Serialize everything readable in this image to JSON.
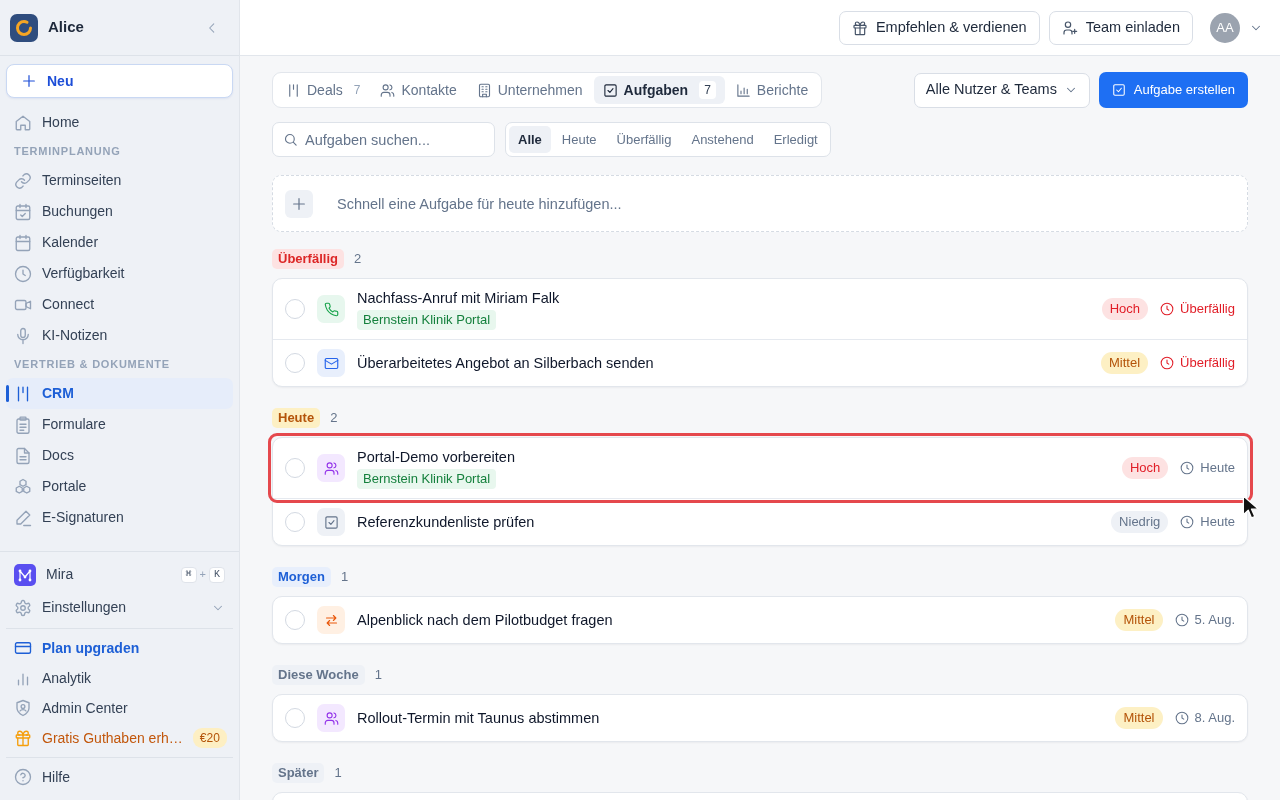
{
  "sidebar": {
    "workspace": "Alice",
    "new_button": "Neu",
    "nav": [
      {
        "kind": "item",
        "label": "Home",
        "selected": false
      },
      {
        "kind": "heading",
        "label": "TERMINPLANUNG"
      },
      {
        "kind": "item",
        "label": "Terminseiten",
        "selected": false
      },
      {
        "kind": "item",
        "label": "Buchungen",
        "selected": false
      },
      {
        "kind": "item",
        "label": "Kalender",
        "selected": false
      },
      {
        "kind": "item",
        "label": "Verfügbarkeit",
        "selected": false
      },
      {
        "kind": "item",
        "label": "Connect",
        "selected": false
      },
      {
        "kind": "item",
        "label": "KI-Notizen",
        "selected": false
      },
      {
        "kind": "heading",
        "label": "VERTRIEB & DOKUMENTE"
      },
      {
        "kind": "item",
        "label": "CRM",
        "selected": true
      },
      {
        "kind": "item",
        "label": "Formulare",
        "selected": false
      },
      {
        "kind": "item",
        "label": "Docs",
        "selected": false
      },
      {
        "kind": "item",
        "label": "Portale",
        "selected": false
      },
      {
        "kind": "item",
        "label": "E-Signaturen",
        "selected": false
      }
    ],
    "assistant": {
      "label": "Mira",
      "shortcut": {
        "keys": [
          "⌘",
          "K"
        ],
        "joiner": "+"
      }
    },
    "settings": {
      "label": "Einstellungen",
      "expanded": false
    },
    "links": [
      {
        "kind": "upgrade",
        "label": "Plan upgraden"
      },
      {
        "kind": "plain",
        "label": "Analytik"
      },
      {
        "kind": "plain",
        "label": "Admin Center"
      },
      {
        "kind": "promo",
        "label": "Gratis Guthaben erh…",
        "badge": "€20"
      }
    ],
    "help": "Hilfe"
  },
  "topbar": {
    "buttons": [
      "Empfehlen & verdienen",
      "Team einladen"
    ],
    "avatar": "AA"
  },
  "tabs": [
    {
      "label": "Deals",
      "count": "7",
      "selected": false
    },
    {
      "label": "Kontakte",
      "selected": false
    },
    {
      "label": "Unternehmen",
      "selected": false
    },
    {
      "label": "Aufgaben",
      "count": "7",
      "selected": true
    },
    {
      "label": "Berichte",
      "selected": false
    }
  ],
  "owner_filter": {
    "value": "Alle Nutzer & Teams"
  },
  "create_button": "Aufgabe erstellen",
  "search": {
    "placeholder": "Aufgaben suchen..."
  },
  "filters": [
    {
      "label": "Alle",
      "selected": true
    },
    {
      "label": "Heute",
      "selected": false
    },
    {
      "label": "Überfällig",
      "selected": false
    },
    {
      "label": "Anstehend",
      "selected": false
    },
    {
      "label": "Erledigt",
      "selected": false
    }
  ],
  "quick_add": {
    "placeholder": "Schnell eine Aufgabe für heute hinzufügen..."
  },
  "groups": [
    {
      "label": "Überfällig",
      "kind": "overdue",
      "count": "2",
      "tasks": [
        {
          "kind": "call",
          "title": "Nachfass-Anruf mit Miriam Falk",
          "tag": "Bernstein Klinik Portal",
          "priority": {
            "label": "Hoch",
            "kind": "high"
          },
          "due": {
            "text": "Überfällig",
            "overdue": true
          },
          "done": false,
          "highlighted": false
        },
        {
          "kind": "email",
          "title": "Überarbeitetes Angebot an Silberbach senden",
          "priority": {
            "label": "Mittel",
            "kind": "medium"
          },
          "due": {
            "text": "Überfällig",
            "overdue": true
          },
          "done": false,
          "highlighted": false
        }
      ]
    },
    {
      "label": "Heute",
      "kind": "today",
      "count": "2",
      "tasks": [
        {
          "kind": "meeting",
          "title": "Portal-Demo vorbereiten",
          "tag": "Bernstein Klinik Portal",
          "priority": {
            "label": "Hoch",
            "kind": "high"
          },
          "due": {
            "text": "Heute",
            "overdue": false
          },
          "done": false,
          "highlighted": true
        },
        {
          "kind": "todo",
          "title": "Referenzkundenliste prüfen",
          "priority": {
            "label": "Niedrig",
            "kind": "low"
          },
          "due": {
            "text": "Heute",
            "overdue": false
          },
          "done": false,
          "highlighted": false
        }
      ]
    },
    {
      "label": "Morgen",
      "kind": "tomorrow",
      "count": "1",
      "tasks": [
        {
          "kind": "follow_up",
          "title": "Alpenblick nach dem Pilotbudget fragen",
          "priority": {
            "label": "Mittel",
            "kind": "medium"
          },
          "due": {
            "text": "5. Aug.",
            "overdue": false
          },
          "done": false,
          "highlighted": false
        }
      ]
    },
    {
      "label": "Diese Woche",
      "kind": "week",
      "count": "1",
      "tasks": [
        {
          "kind": "meeting",
          "title": "Rollout-Termin mit Taunus abstimmen",
          "priority": {
            "label": "Mittel",
            "kind": "medium"
          },
          "due": {
            "text": "8. Aug.",
            "overdue": false
          },
          "done": false,
          "highlighted": false
        }
      ]
    },
    {
      "label": "Später",
      "kind": "later",
      "count": "1",
      "continues_below": true
    }
  ]
}
